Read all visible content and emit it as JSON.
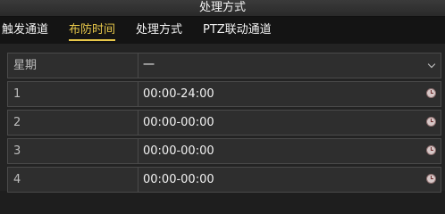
{
  "window": {
    "title": "处理方式"
  },
  "tabs": [
    {
      "label": "触发通道",
      "active": false
    },
    {
      "label": "布防时间",
      "active": true
    },
    {
      "label": "处理方式",
      "active": false
    },
    {
      "label": "PTZ联动通道",
      "active": false
    }
  ],
  "weekday": {
    "label": "星期",
    "value": "一"
  },
  "schedule": [
    {
      "index": "1",
      "time": "00:00-24:00"
    },
    {
      "index": "2",
      "time": "00:00-00:00"
    },
    {
      "index": "3",
      "time": "00:00-00:00"
    },
    {
      "index": "4",
      "time": "00:00-00:00"
    }
  ],
  "colors": {
    "accent": "#e8c84a",
    "background": "#1e1e1e",
    "row_background": "#2e2e2e",
    "border": "#4a4a4a"
  },
  "icons": {
    "time_picker": "clock-icon",
    "dropdown": "chevron-down-icon"
  }
}
